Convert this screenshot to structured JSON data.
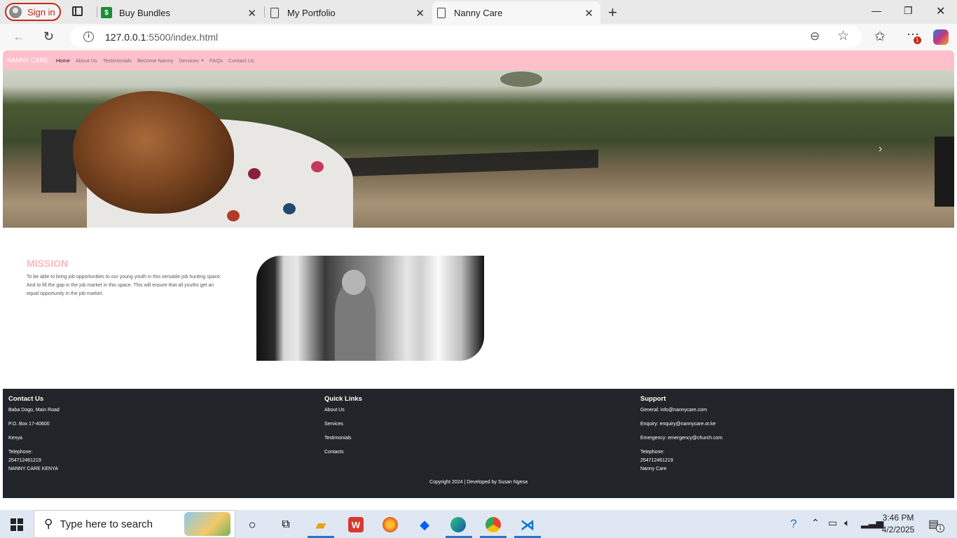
{
  "browser": {
    "signin_label": "Sign in",
    "tabs": [
      {
        "title": "Buy Bundles"
      },
      {
        "title": "My Portfolio"
      },
      {
        "title": "Nanny Care"
      }
    ],
    "url_host": "127.0.0.1",
    "url_path": ":5500/index.html",
    "notification_count": "1"
  },
  "site": {
    "brand": "NANNY CARE",
    "nav": [
      "Home",
      "About Us",
      "Testimonials",
      "Become Nanny",
      "Services",
      "FAQs",
      "Contact Us"
    ],
    "mission_title": "MISSION",
    "mission_text": "To be able to bring job opportunities to our young youth in this versatile job hunting space. And to fill the gap in the job market in this space. This will ensure that all youths get an equal opportunity in the job market."
  },
  "footer": {
    "contact": {
      "title": "Contact Us",
      "address": "Baba Dogo, Main Road",
      "pobox": "P.O. Box 17-40600",
      "country": "Kenya",
      "tel_label": "Telephone:",
      "tel": "254712461219",
      "org": "NANNY CARE KENYA"
    },
    "quick_links": {
      "title": "Quick Links",
      "links": [
        "About Us",
        "Services",
        "Testimonials",
        "Contacts"
      ]
    },
    "support": {
      "title": "Support",
      "general": "General: info@nannycare.com",
      "enquiry": "Enquiry: enquiry@nannycare.or.ke",
      "emergency": "Emergency: emergency@church.com",
      "tel_label": "Telephone:",
      "tel": "254712461219",
      "org": "Nanny Care"
    },
    "copyright": "Copyright 2024 | Developed by Susan Ngesa"
  },
  "taskbar": {
    "search_placeholder": "Type here to search",
    "time": "3:46 PM",
    "date": "4/2/2025",
    "notif_badge": "1"
  },
  "colors": {
    "nav_pink": "#ffc0cb",
    "mission_pink": "#ffb6c1",
    "footer_dark": "#212529"
  }
}
